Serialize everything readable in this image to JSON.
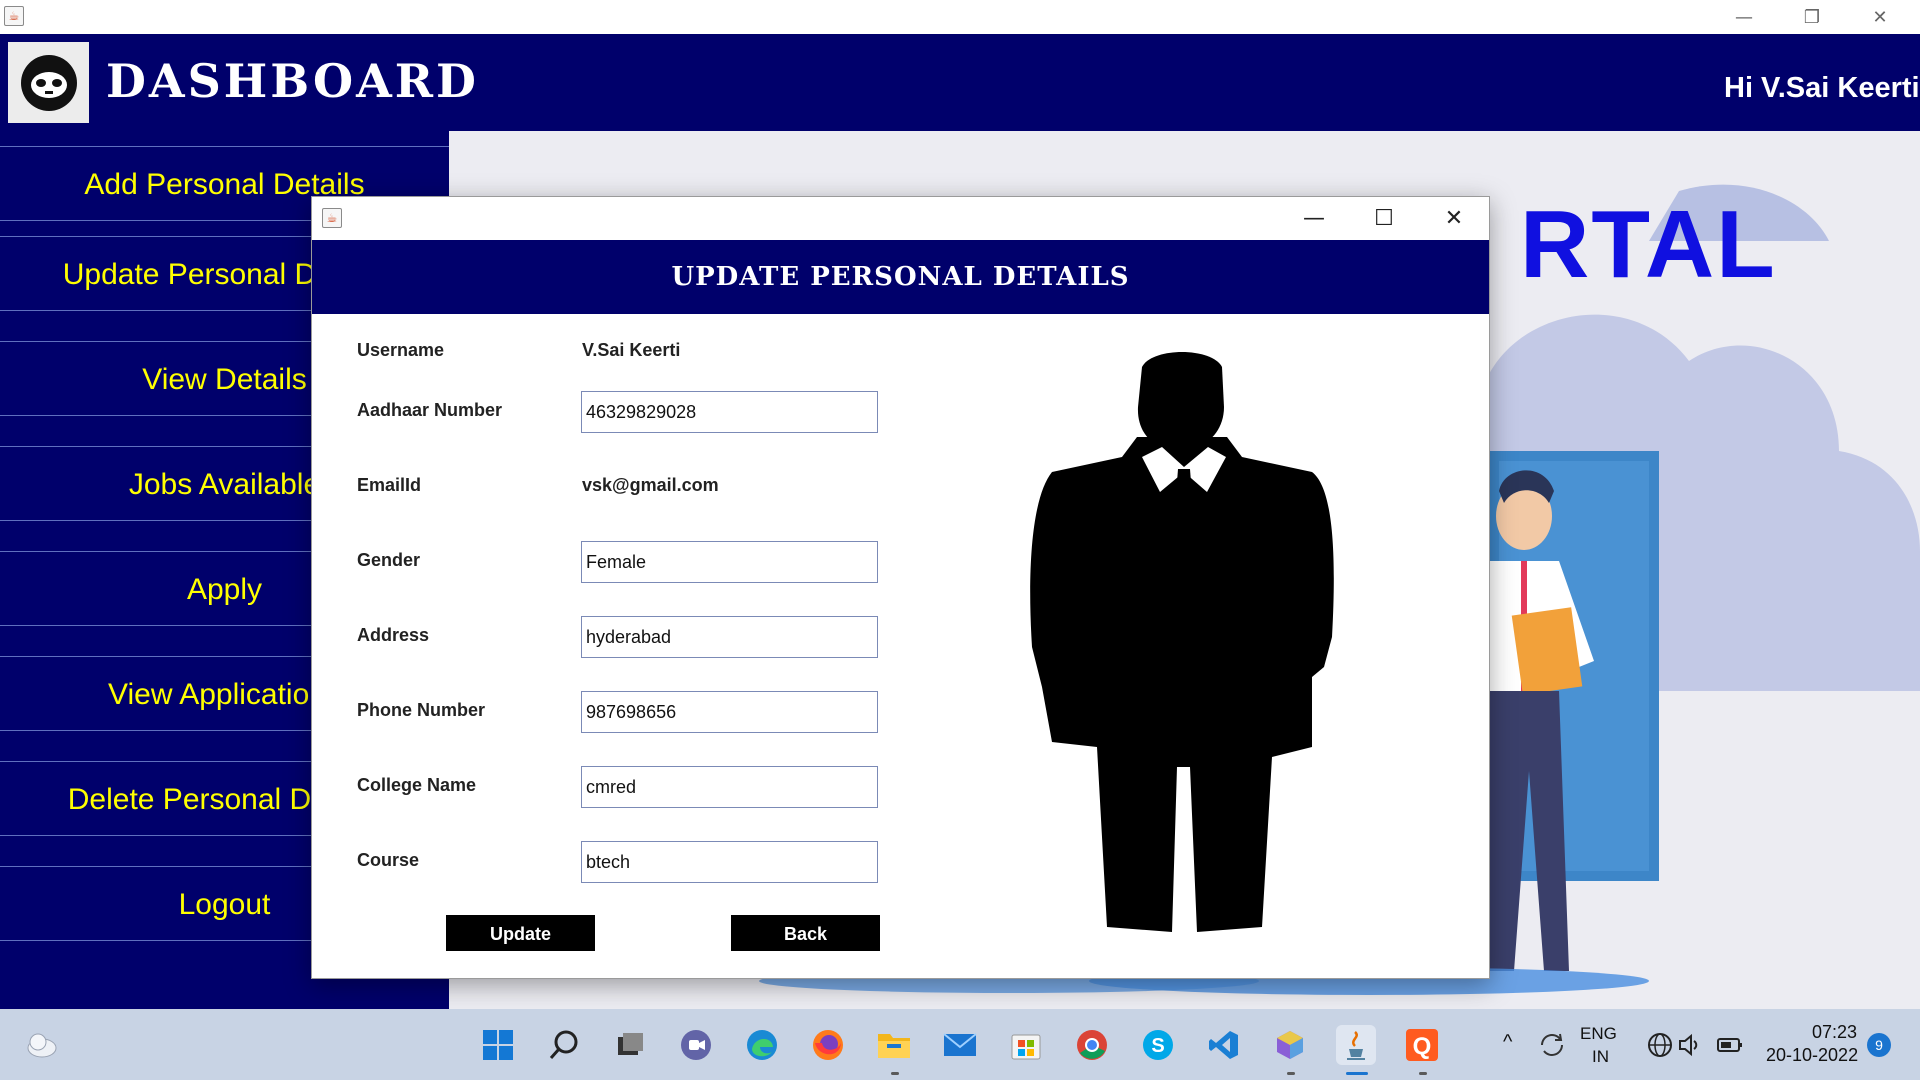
{
  "window": {
    "minimize_icon": "minimize-icon",
    "restore_icon": "restore-icon",
    "close_icon": "close-icon"
  },
  "dashboard": {
    "title": "DASHBOARD",
    "greeting": "Hi V.Sai Keerti",
    "logo_icon": "hacker-mask-icon",
    "background_text": "RTAL"
  },
  "sidebar": {
    "items": [
      {
        "label": "Add Personal Details"
      },
      {
        "label": "Update Personal Details"
      },
      {
        "label": "View Details"
      },
      {
        "label": "Jobs Available"
      },
      {
        "label": "Apply"
      },
      {
        "label": "View Applications"
      },
      {
        "label": "Delete Personal Details"
      },
      {
        "label": "Logout"
      }
    ]
  },
  "dialog": {
    "heading": "UPDATE PERSONAL DETAILS",
    "fields": {
      "username": {
        "label": "Username",
        "value": "V.Sai Keerti"
      },
      "aadhaar": {
        "label": "Aadhaar Number",
        "value": "46329829028"
      },
      "email": {
        "label": "EmailId",
        "value": "vsk@gmail.com"
      },
      "gender": {
        "label": "Gender",
        "value": "Female"
      },
      "address": {
        "label": "Address",
        "value": "hyderabad"
      },
      "phone": {
        "label": "Phone Number",
        "value": "987698656"
      },
      "college": {
        "label": "College Name",
        "value": "cmred"
      },
      "course": {
        "label": "Course",
        "value": "btech"
      }
    },
    "buttons": {
      "update": "Update",
      "back": "Back"
    }
  },
  "taskbar": {
    "icons": [
      "weather-icon",
      "windows-start-icon",
      "search-icon",
      "task-view-icon",
      "teams-chat-icon",
      "edge-icon",
      "firefox-icon",
      "file-explorer-icon",
      "mail-icon",
      "store-icon",
      "chrome-icon",
      "skype-icon",
      "vscode-icon",
      "cube-app-icon",
      "java-icon",
      "q-app-icon"
    ],
    "tray": {
      "lang_1": "ENG",
      "lang_2": "IN",
      "time": "07:23",
      "date": "20-10-2022",
      "badge": "9"
    }
  }
}
